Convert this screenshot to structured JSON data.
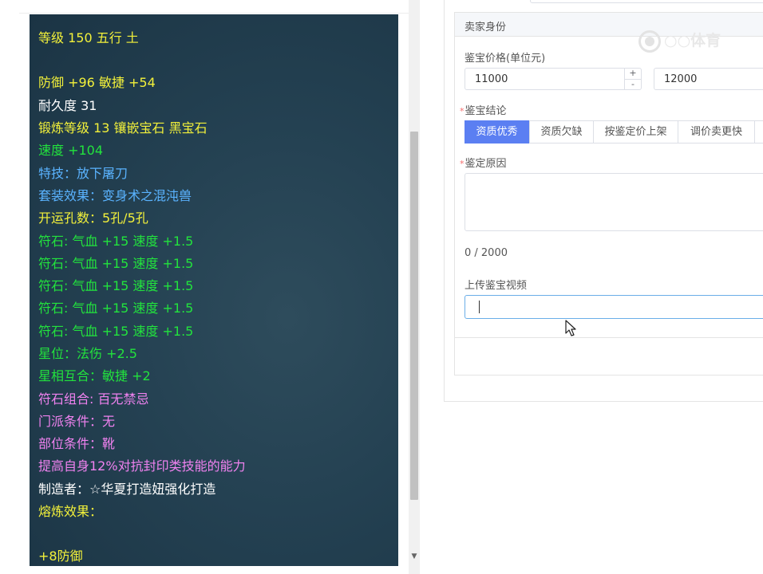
{
  "item_panel": {
    "lines": [
      {
        "text": "等级 150 五行 土",
        "color": "yellow"
      },
      {
        "text": "防御 +96 敏捷 +54",
        "color": "yellow"
      },
      {
        "text": "耐久度 31",
        "color": "white"
      },
      {
        "text": "锻炼等级 13 镶嵌宝石 黑宝石",
        "color": "yellow"
      },
      {
        "text": "速度 +104",
        "color": "green"
      },
      {
        "text": "特技：放下屠刀",
        "color": "blue"
      },
      {
        "text": "套装效果：变身术之混沌兽",
        "color": "blue"
      },
      {
        "text": "开运孔数：5孔/5孔",
        "color": "yellow"
      },
      {
        "text": "符石: 气血 +15 速度 +1.5",
        "color": "green"
      },
      {
        "text": "符石: 气血 +15 速度 +1.5",
        "color": "green"
      },
      {
        "text": "符石: 气血 +15 速度 +1.5",
        "color": "green"
      },
      {
        "text": "符石: 气血 +15 速度 +1.5",
        "color": "green"
      },
      {
        "text": "符石: 气血 +15 速度 +1.5",
        "color": "green"
      },
      {
        "text": "星位：法伤 +2.5",
        "color": "green"
      },
      {
        "text": "星相互合：敏捷 +2",
        "color": "green"
      },
      {
        "text": "符石组合: 百无禁忌",
        "color": "pink"
      },
      {
        "text": "门派条件：无",
        "color": "pink"
      },
      {
        "text": "部位条件：靴",
        "color": "pink"
      },
      {
        "text": "提高自身12%对抗封印类技能的能力",
        "color": "pink"
      },
      {
        "text": "制造者：☆华夏打造妞强化打造",
        "color": "white"
      },
      {
        "text": "熔炼效果：",
        "color": "yellow"
      },
      {
        "text": "+8防御",
        "color": "yellow"
      }
    ]
  },
  "seller_card": {
    "title": "卖家身份",
    "price_label": "鉴宝价格(单位元)",
    "price_min": "11000",
    "price_max": "12000",
    "stepper_plus": "+",
    "stepper_minus": "-",
    "conclusion_label": "鉴宝结论",
    "conclusion_options": [
      "资质优秀",
      "资质欠缺",
      "按鉴定价上架",
      "调价卖更快"
    ],
    "conclusion_selected": "资质优秀",
    "reason_label": "鉴定原因",
    "reason_value": "",
    "reason_counter": "0 / 2000",
    "video_label": "上传鉴宝视频",
    "video_value": "",
    "required_mark": "*"
  },
  "watermark": {
    "text": "○○体育"
  },
  "colors": {
    "yellow": "#f3f13a",
    "white": "#ffffff",
    "green": "#22e33d",
    "blue": "#5ab3ff",
    "pink": "#f082f0",
    "primary": "#5b7ff2",
    "focus_border": "#6aaee8"
  },
  "icons": {
    "scroll_down": "chevron-down-icon",
    "pointer": "mouse-cursor-icon"
  }
}
